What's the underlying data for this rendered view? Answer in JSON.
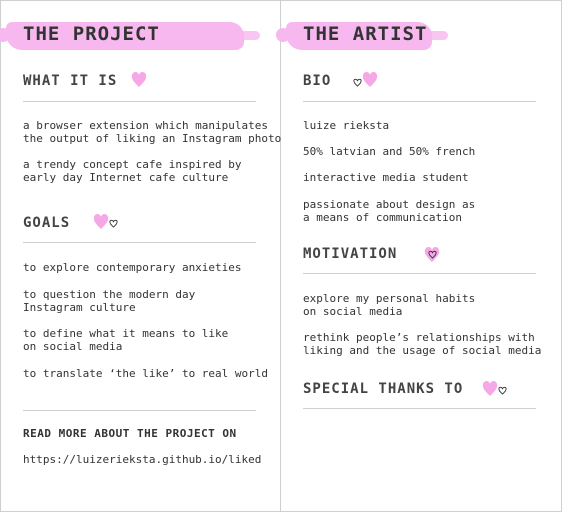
{
  "project": {
    "title": "THE PROJECT",
    "what_it_is": {
      "heading": "WHAT IT IS",
      "items": [
        "a browser extension which manipulates\nthe output of liking an Instagram photo",
        "a trendy concept cafe inspired by\nearly day Internet cafe culture"
      ]
    },
    "goals": {
      "heading": "GOALS",
      "items": [
        "to explore contemporary anxieties",
        "to question the modern day\nInstagram culture",
        "to define what it means to like\non social media",
        "to translate ‘the like’ to real world"
      ]
    },
    "read_more": {
      "heading": "READ MORE ABOUT THE PROJECT ON",
      "link": "https://luizerieksta.github.io/liked"
    }
  },
  "artist": {
    "title": "THE ARTIST",
    "bio": {
      "heading": "BIO",
      "items": [
        "luize rieksta",
        "50% latvian and 50% french",
        "interactive media student",
        "passionate about design as\na means of communication"
      ]
    },
    "motivation": {
      "heading": "MOTIVATION",
      "items": [
        "explore my personal habits\non social media",
        "rethink people’s relationships with\nliking and the usage of social media"
      ]
    },
    "thanks": {
      "heading": "SPECIAL THANKS TO"
    }
  },
  "colors": {
    "brush_pink": "#f7b8ef",
    "heart_pink": "#f6a8e6",
    "text": "#333333",
    "rule": "#d0d0d0"
  },
  "icons": [
    "pink-heart-icon",
    "small-outline-heart-icon"
  ]
}
